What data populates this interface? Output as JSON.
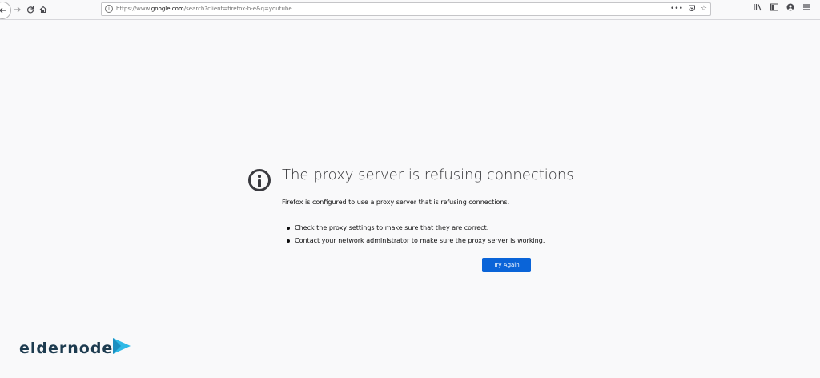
{
  "browser": {
    "url_prefix": "https://www.",
    "url_host": "google.com",
    "url_suffix": "/search?client=firefox-b-e&q=youtube",
    "icons": [
      "back-icon",
      "forward-icon",
      "reload-icon",
      "home-icon",
      "info-icon",
      "page-actions-icon",
      "pocket-icon",
      "bookmark-star-icon",
      "library-icon",
      "sidebar-icon",
      "account-icon",
      "menu-icon"
    ]
  },
  "error": {
    "title": "The proxy server is refusing connections",
    "description": "Firefox is configured to use a proxy server that is refusing connections.",
    "suggestions": [
      "Check the proxy settings to make sure that they are correct.",
      "Contact your network administrator to make sure the proxy server is working."
    ],
    "try_again_label": "Try Again"
  },
  "watermark": {
    "text": "eldernode"
  },
  "colors": {
    "accent": "#0a64d8",
    "background": "#f9f9fa",
    "logo": "#1d3b4f",
    "logo_play": "#2fb9e6"
  }
}
